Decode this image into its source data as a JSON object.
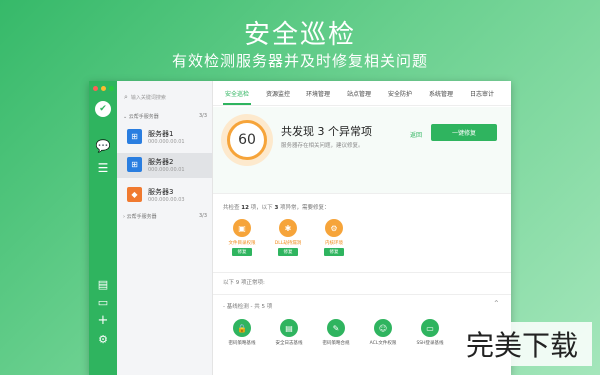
{
  "hero": {
    "title": "安全巡检",
    "subtitle": "有效检测服务器并及时修复相关问题"
  },
  "colors": {
    "brand": "#2fb45f",
    "warning": "#f6a43a",
    "win_blue": "#2a7ee0",
    "server_orange": "#f07a30"
  },
  "sidebar": {
    "icons": [
      "shield-icon",
      "chat-icon",
      "list-icon",
      "storage-icon",
      "monitor-icon",
      "plus-icon",
      "settings-icon"
    ]
  },
  "servers": {
    "search_placeholder": "输入关键词搜索",
    "cloud_group": {
      "label": "云帮手服务器",
      "count": "3/3"
    },
    "items": [
      {
        "name": "服务器1",
        "ip": "000.000.00.01"
      },
      {
        "name": "服务器2",
        "ip": "000.000.00.01"
      },
      {
        "name": "服务器3",
        "ip": "000.000.00.03"
      }
    ],
    "other_group": {
      "label": "云帮手服务器",
      "count": "3/3"
    }
  },
  "tabs": [
    "安全巡检",
    "资源监控",
    "环境管理",
    "站点管理",
    "安全防护",
    "系统管理",
    "日志审计"
  ],
  "summary": {
    "score": "60",
    "title": "共发现 3 个异常项",
    "desc": "服务器存在相关问题，建议修复。",
    "back_label": "返回",
    "fix_all_label": "一键修复"
  },
  "stats": {
    "prefix": "共检查",
    "checked": "12",
    "mid": "项，以下",
    "issues": "3",
    "suffix": "项异常，需要修复："
  },
  "issues": [
    {
      "label": "文件目录权限",
      "fix": "修复",
      "icon": "folder-lock-icon"
    },
    {
      "label": "DLL劫持漏洞",
      "fix": "修复",
      "icon": "bug-icon"
    },
    {
      "label": "内核环境",
      "fix": "修复",
      "icon": "gear-icon"
    }
  ],
  "ok": {
    "line": "以下 9 项正常项:",
    "group_label": "- 基线检测 - 共 5 项",
    "items": [
      {
        "label": "密码策略基线",
        "icon": "lock-icon"
      },
      {
        "label": "安全日志基线",
        "icon": "log-icon"
      },
      {
        "label": "密码策略合规",
        "icon": "key-icon"
      },
      {
        "label": "ACL文件权限",
        "icon": "user-shield-icon"
      },
      {
        "label": "SSH登录基线",
        "icon": "terminal-icon"
      }
    ]
  },
  "watermark": "完美下载"
}
